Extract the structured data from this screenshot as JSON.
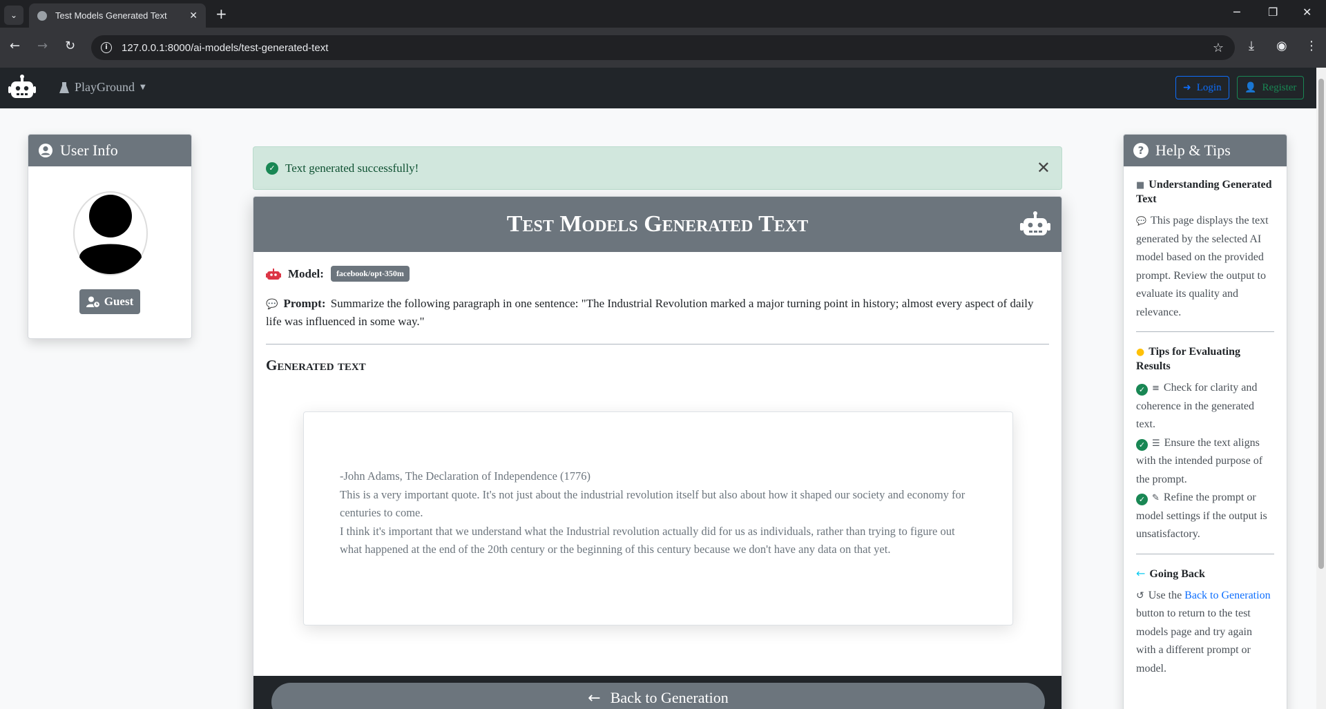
{
  "browser": {
    "tab_title": "Test Models Generated Text",
    "url": "127.0.0.1:8000/ai-models/test-generated-text"
  },
  "navbar": {
    "menu_label": "PlayGround",
    "login_label": "Login",
    "register_label": "Register"
  },
  "user_info": {
    "title": "User Info",
    "guest_label": "Guest"
  },
  "alert": {
    "message": "Text generated successfully!"
  },
  "main": {
    "title": "Test Models Generated Text",
    "model_label": "Model:",
    "model_name": "facebook/opt-350m",
    "prompt_label": "Prompt:",
    "prompt_text": "Summarize the following paragraph in one sentence: \"The Industrial Revolution marked a major turning point in history; almost every aspect of daily life was influenced in some way.\"",
    "generated_title": "Generated text",
    "generated_lines": [
      "-John Adams, The Declaration of Independence (1776)",
      "This is a very important quote. It's not just about the industrial revolution itself but also about how it shaped our society and economy for centuries to come.",
      "I think it's important that we understand what the Industrial revolution actually did for us as individuals, rather than trying to figure out what happened at the end of the 20th century or the beginning of this century because we don't have any data on that yet."
    ],
    "back_label": "Back to Generation"
  },
  "help": {
    "title": "Help & Tips",
    "section1_title": "Understanding Generated Text",
    "section1_text": "This page displays the text generated by the selected AI model based on the provided prompt. Review the output to evaluate its quality and relevance.",
    "section2_title": "Tips for Evaluating Results",
    "tip1": "Check for clarity and coherence in the generated text.",
    "tip2": "Ensure the text aligns with the intended purpose of the prompt.",
    "tip3": "Refine the prompt or model settings if the output is unsatisfactory.",
    "section3_title": "Going Back",
    "back_pre": "Use the",
    "back_link": "Back to Generation",
    "back_post": "button to return to the test models page and try again with a different prompt or model."
  },
  "colors": {
    "navbar_bg": "#212529",
    "card_header": "#6c757d",
    "success_bg": "#d1e7dd",
    "primary": "#0d6efd",
    "success": "#198754"
  }
}
